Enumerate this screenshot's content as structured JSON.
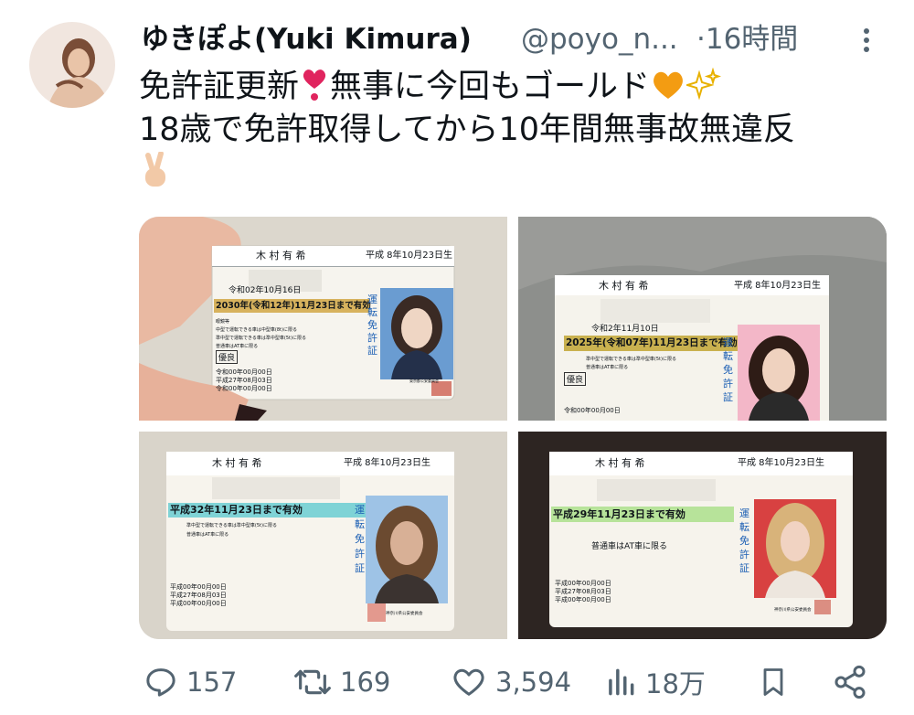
{
  "author": {
    "display_name": "ゆきぽよ(Yuki Kimura)",
    "handle": "@poyo_n...",
    "time": "·16時間"
  },
  "tweet": {
    "line1": "免許証更新",
    "line1b": "無事に今回もゴールド",
    "line2": "18歳で免許取得してから10年間無事故無違反"
  },
  "emojis": [
    "heart-exclamation",
    "orange-heart",
    "sparkles",
    "victory-hand"
  ],
  "photos": [
    {
      "holder": "木 村 有 希",
      "dob": "平成 8年10月23日生",
      "issued": "令和02年10月16日",
      "validity": "2030年(令和12年)11月23日まで有効",
      "badge": "優良",
      "license_type_chars": [
        "運",
        "転",
        "免",
        "許",
        "証"
      ],
      "conditions": [
        "眼鏡等",
        "中型で運転できる車は中型車(8t)に限る",
        "準中型で運転できる車は準中型車(5t)に限る",
        "普通車はAT車に限る"
      ],
      "dates": [
        "令和00年00月00日",
        "平成27年08月03日",
        "令和00年00月00日"
      ],
      "seal": "東京都公安委員会",
      "band_color": "#d7b25d"
    },
    {
      "holder": "木 村 有 希",
      "dob": "平成 8年10月23日生",
      "issued": "令和2年11月10日",
      "validity": "2025年(令和07年)11月23日まで有効",
      "badge": "優良",
      "license_type_chars": [
        "運",
        "転",
        "免",
        "許",
        "証"
      ],
      "conditions": [
        "準中型で運転できる車は準中型車(5t)に限る",
        "普通車はAT車に限る"
      ],
      "dates": [
        "令和00年00月00日"
      ],
      "band_color": "#c9b14f"
    },
    {
      "holder": "木 村 有 希",
      "dob": "平成 8年10月23日生",
      "validity": "平成32年11月23日まで有効",
      "license_type_chars": [
        "運",
        "転",
        "免",
        "許",
        "証"
      ],
      "conditions": [
        "準中型で運転できる車は準中型車(5t)に限る",
        "普通車はAT車に限る"
      ],
      "dates": [
        "平成00年00月00日",
        "平成27年08月03日",
        "平成00年00月00日"
      ],
      "seal": "神奈川県公安委員会",
      "band_color": "#7fd3d6"
    },
    {
      "holder": "木 村 有 希",
      "dob": "平成 8年10月23日生",
      "validity": "平成29年11月23日まで有効",
      "license_type_chars": [
        "運",
        "転",
        "免",
        "許",
        "証"
      ],
      "conditions": [
        "普通車はAT車に限る"
      ],
      "dates": [
        "平成00年00月00日",
        "平成27年08月03日",
        "平成00年00月00日"
      ],
      "seal": "神奈川県公安委員会",
      "band_color": "#b7e39a"
    }
  ],
  "actions": {
    "replies": "157",
    "retweets": "169",
    "likes": "3,594",
    "views": "18万"
  },
  "colors": {
    "text": "#0f1419",
    "secondary": "#536471",
    "heart": "#e0245e",
    "orange_heart": "#f39c12"
  }
}
